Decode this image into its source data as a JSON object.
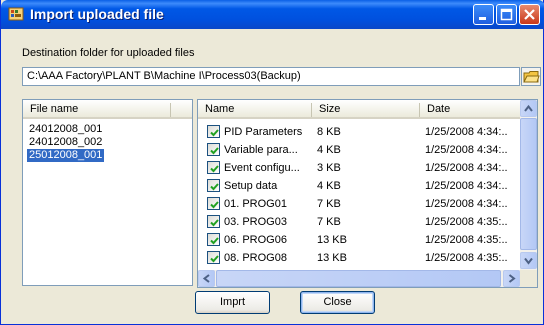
{
  "window": {
    "title": "Import uploaded file",
    "app_icon": "import-file-icon",
    "controls": [
      "minimize-icon",
      "maximize-icon",
      "close-icon"
    ]
  },
  "destination": {
    "label": "Destination folder for uploaded files",
    "path": "C:\\AAA Factory\\PLANT B\\Machine I\\Process03(Backup)",
    "browse_icon": "folder-browse-icon"
  },
  "file_list": {
    "header": "File name",
    "items": [
      {
        "name": "24012008_001",
        "selected": false
      },
      {
        "name": "24012008_002",
        "selected": false
      },
      {
        "name": "25012008_001",
        "selected": true
      }
    ]
  },
  "contents": {
    "columns": [
      "Name",
      "Size",
      "Date"
    ],
    "rows": [
      {
        "checked": true,
        "name": "PID Parameters",
        "size": "8 KB",
        "date": "1/25/2008 4:34:.."
      },
      {
        "checked": true,
        "name": "Variable para...",
        "size": "4 KB",
        "date": "1/25/2008 4:34:.."
      },
      {
        "checked": true,
        "name": "Event configu...",
        "size": "3 KB",
        "date": "1/25/2008 4:34:.."
      },
      {
        "checked": true,
        "name": "Setup data",
        "size": "4 KB",
        "date": "1/25/2008 4:34:.."
      },
      {
        "checked": true,
        "name": "01. PROG01",
        "size": "7 KB",
        "date": "1/25/2008 4:34:.."
      },
      {
        "checked": true,
        "name": "03. PROG03",
        "size": "7 KB",
        "date": "1/25/2008 4:35:.."
      },
      {
        "checked": true,
        "name": "06. PROG06",
        "size": "13 KB",
        "date": "1/25/2008 4:35:.."
      },
      {
        "checked": true,
        "name": "08. PROG08",
        "size": "13 KB",
        "date": "1/25/2008 4:35:.."
      }
    ]
  },
  "buttons": {
    "import_label": "Imprt",
    "close_label": "Close"
  },
  "colors": {
    "titlebar": "#0054e3",
    "selection": "#316ac5",
    "dialog_bg": "#ece9d8"
  }
}
